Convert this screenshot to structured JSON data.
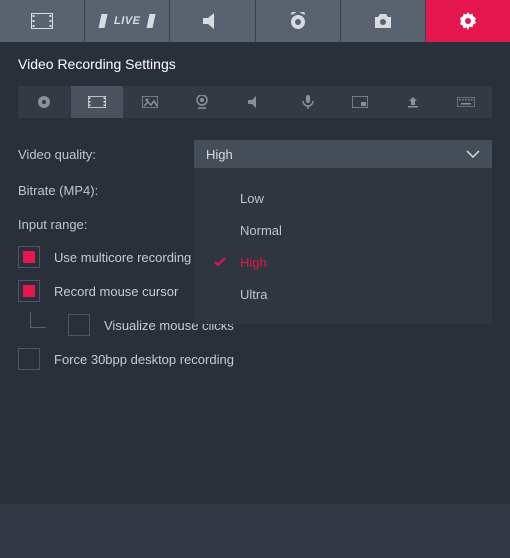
{
  "colors": {
    "accent": "#e6164e",
    "panel": "#29303a",
    "dropdown": "#2f3640"
  },
  "top_tabs": {
    "live_label": "LIVE"
  },
  "panel": {
    "title": "Video Recording Settings"
  },
  "video_quality": {
    "label": "Video quality:",
    "selected": "High",
    "options": {
      "low": "Low",
      "normal": "Normal",
      "high": "High",
      "ultra": "Ultra"
    }
  },
  "bitrate": {
    "label": "Bitrate (MP4):"
  },
  "input_range": {
    "label": "Input range:"
  },
  "checkboxes": {
    "multicore": "Use multicore recording",
    "mouse_cursor": "Record mouse cursor",
    "visualize_clicks": "Visualize mouse clicks",
    "force_30bpp": "Force 30bpp desktop recording"
  }
}
